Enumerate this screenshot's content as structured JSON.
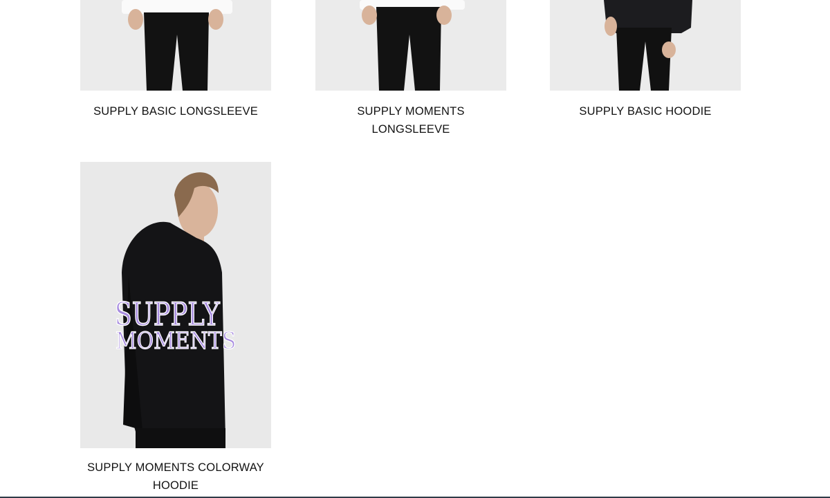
{
  "products": [
    {
      "name": "SUPPLY BASIC LONGSLEEVE",
      "image": "model-white-longsleeve-black-pants"
    },
    {
      "name": "SUPPLY MOMENTS LONGSLEEVE",
      "image": "model-white-longsleeve-black-pants"
    },
    {
      "name": "SUPPLY BASIC HOODIE",
      "image": "model-black-hoodie-side"
    },
    {
      "name": "SUPPLY MOMENTS COLORWAY HOODIE",
      "image": "model-black-hoodie-back-print",
      "print_text": [
        "SUPPLY",
        "MOMENTS"
      ],
      "print_color": "#a78be0"
    }
  ]
}
